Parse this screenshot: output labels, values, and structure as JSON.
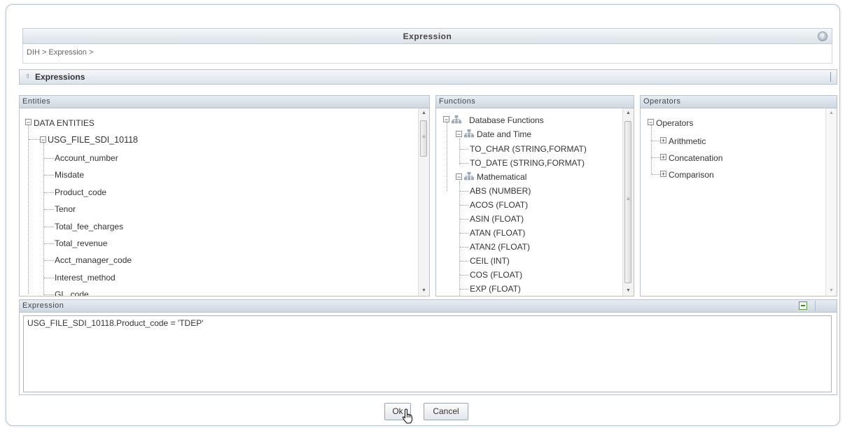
{
  "dialog": {
    "title": "Expression",
    "help_label": "?",
    "breadcrumb": "DIH > Expression >"
  },
  "section": {
    "title": "Expressions"
  },
  "entities": {
    "header": "Entities",
    "root": "DATA ENTITIES",
    "table": "USG_FILE_SDI_10118",
    "columns": [
      "Account_number",
      "Misdate",
      "Product_code",
      "Tenor",
      "Total_fee_charges",
      "Total_revenue",
      "Acct_manager_code",
      "Interest_method",
      "GL_code"
    ]
  },
  "functions": {
    "header": "Functions",
    "root": "Database Functions",
    "groups": [
      {
        "label": "Date and Time",
        "items": [
          "TO_CHAR (STRING,FORMAT)",
          "TO_DATE (STRING,FORMAT)"
        ]
      },
      {
        "label": "Mathematical",
        "items": [
          "ABS (NUMBER)",
          "ACOS (FLOAT)",
          "ASIN (FLOAT)",
          "ATAN (FLOAT)",
          "ATAN2 (FLOAT)",
          "CEIL (INT)",
          "COS (FLOAT)",
          "EXP (FLOAT)"
        ]
      }
    ]
  },
  "operators": {
    "header": "Operators",
    "root": "Operators",
    "items": [
      "Arithmetic",
      "Concatenation",
      "Comparison"
    ]
  },
  "expression": {
    "header": "Expression",
    "value": "USG_FILE_SDI_10118.Product_code = 'TDEP'"
  },
  "buttons": {
    "ok": "Ok",
    "cancel": "Cancel"
  }
}
